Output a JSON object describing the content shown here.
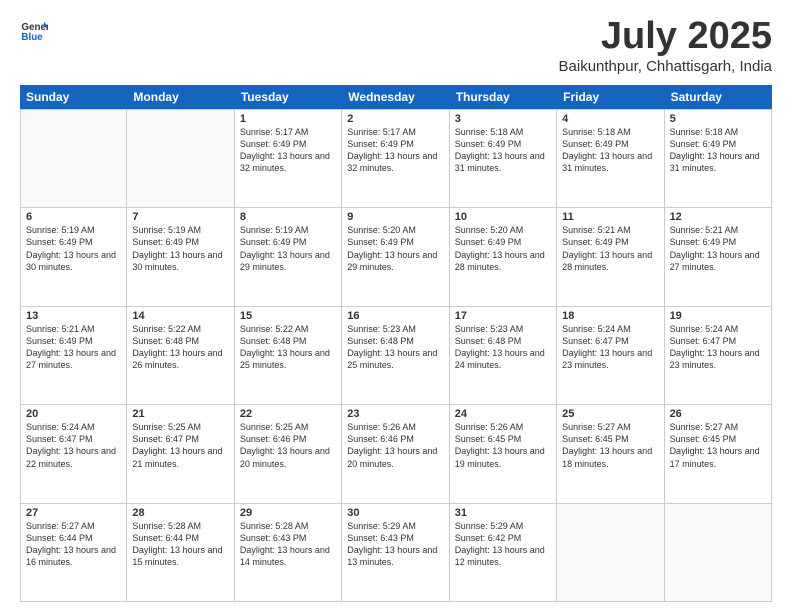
{
  "header": {
    "logo_line1": "General",
    "logo_line2": "Blue",
    "month_title": "July 2025",
    "location": "Baikunthpur, Chhattisgarh, India"
  },
  "days_of_week": [
    "Sunday",
    "Monday",
    "Tuesday",
    "Wednesday",
    "Thursday",
    "Friday",
    "Saturday"
  ],
  "weeks": [
    [
      {
        "day": "",
        "empty": true
      },
      {
        "day": "",
        "empty": true
      },
      {
        "day": "1",
        "sunrise": "Sunrise: 5:17 AM",
        "sunset": "Sunset: 6:49 PM",
        "daylight": "Daylight: 13 hours and 32 minutes."
      },
      {
        "day": "2",
        "sunrise": "Sunrise: 5:17 AM",
        "sunset": "Sunset: 6:49 PM",
        "daylight": "Daylight: 13 hours and 32 minutes."
      },
      {
        "day": "3",
        "sunrise": "Sunrise: 5:18 AM",
        "sunset": "Sunset: 6:49 PM",
        "daylight": "Daylight: 13 hours and 31 minutes."
      },
      {
        "day": "4",
        "sunrise": "Sunrise: 5:18 AM",
        "sunset": "Sunset: 6:49 PM",
        "daylight": "Daylight: 13 hours and 31 minutes."
      },
      {
        "day": "5",
        "sunrise": "Sunrise: 5:18 AM",
        "sunset": "Sunset: 6:49 PM",
        "daylight": "Daylight: 13 hours and 31 minutes."
      }
    ],
    [
      {
        "day": "6",
        "sunrise": "Sunrise: 5:19 AM",
        "sunset": "Sunset: 6:49 PM",
        "daylight": "Daylight: 13 hours and 30 minutes."
      },
      {
        "day": "7",
        "sunrise": "Sunrise: 5:19 AM",
        "sunset": "Sunset: 6:49 PM",
        "daylight": "Daylight: 13 hours and 30 minutes."
      },
      {
        "day": "8",
        "sunrise": "Sunrise: 5:19 AM",
        "sunset": "Sunset: 6:49 PM",
        "daylight": "Daylight: 13 hours and 29 minutes."
      },
      {
        "day": "9",
        "sunrise": "Sunrise: 5:20 AM",
        "sunset": "Sunset: 6:49 PM",
        "daylight": "Daylight: 13 hours and 29 minutes."
      },
      {
        "day": "10",
        "sunrise": "Sunrise: 5:20 AM",
        "sunset": "Sunset: 6:49 PM",
        "daylight": "Daylight: 13 hours and 28 minutes."
      },
      {
        "day": "11",
        "sunrise": "Sunrise: 5:21 AM",
        "sunset": "Sunset: 6:49 PM",
        "daylight": "Daylight: 13 hours and 28 minutes."
      },
      {
        "day": "12",
        "sunrise": "Sunrise: 5:21 AM",
        "sunset": "Sunset: 6:49 PM",
        "daylight": "Daylight: 13 hours and 27 minutes."
      }
    ],
    [
      {
        "day": "13",
        "sunrise": "Sunrise: 5:21 AM",
        "sunset": "Sunset: 6:49 PM",
        "daylight": "Daylight: 13 hours and 27 minutes."
      },
      {
        "day": "14",
        "sunrise": "Sunrise: 5:22 AM",
        "sunset": "Sunset: 6:48 PM",
        "daylight": "Daylight: 13 hours and 26 minutes."
      },
      {
        "day": "15",
        "sunrise": "Sunrise: 5:22 AM",
        "sunset": "Sunset: 6:48 PM",
        "daylight": "Daylight: 13 hours and 25 minutes."
      },
      {
        "day": "16",
        "sunrise": "Sunrise: 5:23 AM",
        "sunset": "Sunset: 6:48 PM",
        "daylight": "Daylight: 13 hours and 25 minutes."
      },
      {
        "day": "17",
        "sunrise": "Sunrise: 5:23 AM",
        "sunset": "Sunset: 6:48 PM",
        "daylight": "Daylight: 13 hours and 24 minutes."
      },
      {
        "day": "18",
        "sunrise": "Sunrise: 5:24 AM",
        "sunset": "Sunset: 6:47 PM",
        "daylight": "Daylight: 13 hours and 23 minutes."
      },
      {
        "day": "19",
        "sunrise": "Sunrise: 5:24 AM",
        "sunset": "Sunset: 6:47 PM",
        "daylight": "Daylight: 13 hours and 23 minutes."
      }
    ],
    [
      {
        "day": "20",
        "sunrise": "Sunrise: 5:24 AM",
        "sunset": "Sunset: 6:47 PM",
        "daylight": "Daylight: 13 hours and 22 minutes."
      },
      {
        "day": "21",
        "sunrise": "Sunrise: 5:25 AM",
        "sunset": "Sunset: 6:47 PM",
        "daylight": "Daylight: 13 hours and 21 minutes."
      },
      {
        "day": "22",
        "sunrise": "Sunrise: 5:25 AM",
        "sunset": "Sunset: 6:46 PM",
        "daylight": "Daylight: 13 hours and 20 minutes."
      },
      {
        "day": "23",
        "sunrise": "Sunrise: 5:26 AM",
        "sunset": "Sunset: 6:46 PM",
        "daylight": "Daylight: 13 hours and 20 minutes."
      },
      {
        "day": "24",
        "sunrise": "Sunrise: 5:26 AM",
        "sunset": "Sunset: 6:45 PM",
        "daylight": "Daylight: 13 hours and 19 minutes."
      },
      {
        "day": "25",
        "sunrise": "Sunrise: 5:27 AM",
        "sunset": "Sunset: 6:45 PM",
        "daylight": "Daylight: 13 hours and 18 minutes."
      },
      {
        "day": "26",
        "sunrise": "Sunrise: 5:27 AM",
        "sunset": "Sunset: 6:45 PM",
        "daylight": "Daylight: 13 hours and 17 minutes."
      }
    ],
    [
      {
        "day": "27",
        "sunrise": "Sunrise: 5:27 AM",
        "sunset": "Sunset: 6:44 PM",
        "daylight": "Daylight: 13 hours and 16 minutes."
      },
      {
        "day": "28",
        "sunrise": "Sunrise: 5:28 AM",
        "sunset": "Sunset: 6:44 PM",
        "daylight": "Daylight: 13 hours and 15 minutes."
      },
      {
        "day": "29",
        "sunrise": "Sunrise: 5:28 AM",
        "sunset": "Sunset: 6:43 PM",
        "daylight": "Daylight: 13 hours and 14 minutes."
      },
      {
        "day": "30",
        "sunrise": "Sunrise: 5:29 AM",
        "sunset": "Sunset: 6:43 PM",
        "daylight": "Daylight: 13 hours and 13 minutes."
      },
      {
        "day": "31",
        "sunrise": "Sunrise: 5:29 AM",
        "sunset": "Sunset: 6:42 PM",
        "daylight": "Daylight: 13 hours and 12 minutes."
      },
      {
        "day": "",
        "empty": true
      },
      {
        "day": "",
        "empty": true
      }
    ]
  ]
}
